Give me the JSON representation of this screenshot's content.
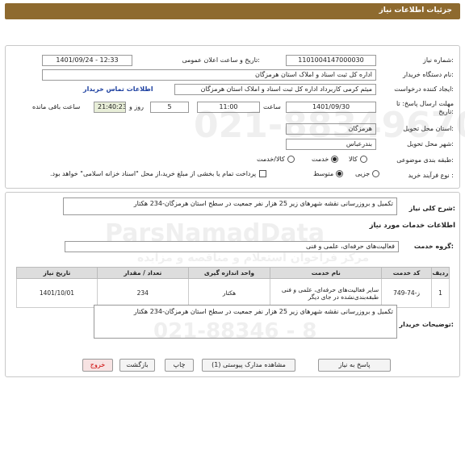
{
  "title": "جزئیات اطلاعات نیاز",
  "info": {
    "need_number_label": "شماره نیاز:",
    "need_number": "1101004147000030",
    "announce_label": "تاریخ و ساعت اعلان عمومی:",
    "announce_value": "1401/09/24 - 12:33",
    "buyer_label": "نام دستگاه خریدار:",
    "buyer_value": "اداره کل ثبت اسناد و املاک استان هرمزگان",
    "creator_label": "ایجاد کننده درخواست:",
    "creator_value": "میثم کرمی کاربرداد اداره کل ثبت اسناد و املاک استان هرمزگان",
    "contact_link": "اطلاعات تماس خریدار",
    "deadline_label": "مهلت ارسال پاسخ: تا",
    "deadline_label2": "تاریخ:",
    "deadline_date": "1401/09/30",
    "time_label": "ساعت",
    "deadline_time": "11:00",
    "days_value": "5",
    "days_label": "روز و",
    "remain_time": "21:40:23",
    "remain_label": "ساعت باقی مانده",
    "province_label": "استان محل تحویل:",
    "province_value": "هرمزگان",
    "city_label": "شهر محل تحویل:",
    "city_value": "بندرعباس",
    "category_label": "طبقه بندی موضوعی:",
    "category_options": [
      "کالا",
      "خدمت",
      "کالا/خدمت"
    ],
    "process_label": "نوع فرآیند خرید :",
    "process_options": [
      "جزیی",
      "متوسط"
    ],
    "payment_note": "پرداخت تمام یا بخشی از مبلغ خرید،از محل \"اسناد خزانه اسلامی\" خواهد بود."
  },
  "summary": {
    "label": "شرح کلی نیاز:",
    "value": "تکمیل و بروزرسانی نقشه شهرهای زیر 25 هزار نفر جمعیت در سطح استان هرمزگان-234 هکتار"
  },
  "services": {
    "section_title": "اطلاعات خدمات مورد نیاز",
    "group_label": "گروه خدمت:",
    "group_value": "فعالیت‌های حرفه‌ای، علمی و فنی",
    "columns": [
      "ردیف",
      "کد خدمت",
      "نام خدمت",
      "واحد اندازه گیری",
      "تعداد / مقدار",
      "تاریخ نیاز"
    ],
    "rows": [
      {
        "row": "1",
        "code": "ز-74-749",
        "name": "سایر فعالیت‌های حرفه‌ای، علمی و فنی طبقه‌بندی‌نشده در جای دیگر",
        "unit": "هکتار",
        "qty": "234",
        "date": "1401/10/01"
      }
    ]
  },
  "buyer_notes": {
    "label": "توضیحات خریدار:",
    "value": "تکمیل و بروزرسانی نقشه شهرهای زیر 25 هزار نفر جمعیت در سطح استان هرمزگان-234 هکتار"
  },
  "buttons": {
    "reply": "پاسخ به نیاز",
    "attachments": "مشاهده مدارک پیوستی (1)",
    "print": "چاپ",
    "back": "بازگشت",
    "exit": "خروج"
  },
  "watermark": {
    "line1": "ParsNamadData",
    "line2": "مرکز فراخوان استعلام و مناقصه و مزایده",
    "phone1": "021-88349670",
    "phone2": "021-88346 - 8"
  }
}
